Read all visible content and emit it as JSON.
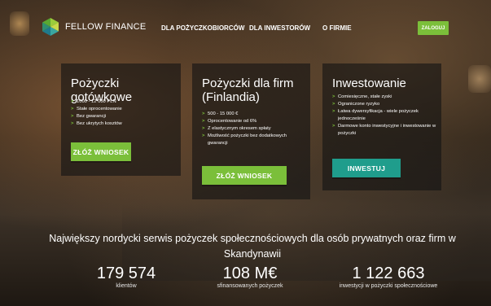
{
  "header": {
    "logo_text": "FELLOW FINANCE",
    "nav": [
      "DLA POŻYCZKOBIORCÓW",
      "DLA INWESTORÓW",
      "O FIRMIE"
    ],
    "login_label": "ZALOGUJ"
  },
  "cards": [
    {
      "title": "Pożyczki gotówkowe",
      "features": [
        "1000 - 12 000 PLN",
        "Stałe oprocentowanie",
        "Bez gwarancji",
        "Bez ukrytych kosztów"
      ],
      "button": "ZŁÓŻ WNIOSEK"
    },
    {
      "title": "Pożyczki dla firm (Finlandia)",
      "features": [
        "500 - 15 000 €",
        "Oprocentowanie od 6%",
        "Z elastycznym okresem spłaty",
        "Możliwość pożyczki bez dodatkowych gwarancji"
      ],
      "button": "ZŁÓŻ WNIOSEK"
    },
    {
      "title": "Inwestowanie",
      "features": [
        "Comiesięczne, stałe zyski",
        "Ograniczone ryzyko",
        "Łatwa dywersyfikacja - wiele pożyczek jednocześnie",
        "Darmowe konto inwestycyjne i inwestowanie w pożyczki"
      ],
      "button": "INWESTUJ"
    }
  ],
  "hero": {
    "tagline": "Największy nordycki serwis pożyczek społecznościowych dla osób prywatnych oraz firm w Skandynawii"
  },
  "stats": [
    {
      "value": "179 574",
      "label": "klientów"
    },
    {
      "value": "108 M€",
      "label": "sfinansowanych pożyczek"
    },
    {
      "value": "1 122 663",
      "label": "inwestycji w pożyczki społecznościowe"
    }
  ],
  "colors": {
    "accent_green": "#7bbf3a",
    "accent_teal": "#1f9d8c",
    "card_bg": "rgba(20,20,20,0.62)"
  },
  "icons": {
    "logo": "fellow-finance-hexagon-logo"
  }
}
